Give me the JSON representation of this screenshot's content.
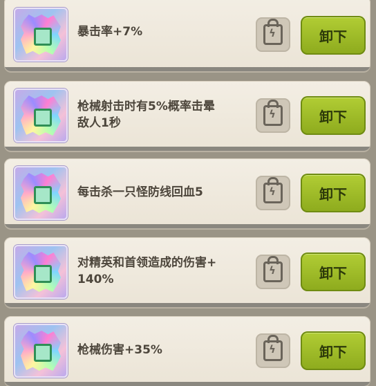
{
  "items": [
    {
      "text": "暴击率+7%",
      "button": "卸下"
    },
    {
      "text": "枪械射击时有5%概率击晕\n敌人1秒",
      "button": "卸下"
    },
    {
      "text": "每击杀一只怪防线回血5",
      "button": "卸下"
    },
    {
      "text": "对精英和首领造成的伤害+\n140%",
      "button": "卸下"
    },
    {
      "text": "枪械伤害+35%",
      "button": "卸下"
    }
  ]
}
